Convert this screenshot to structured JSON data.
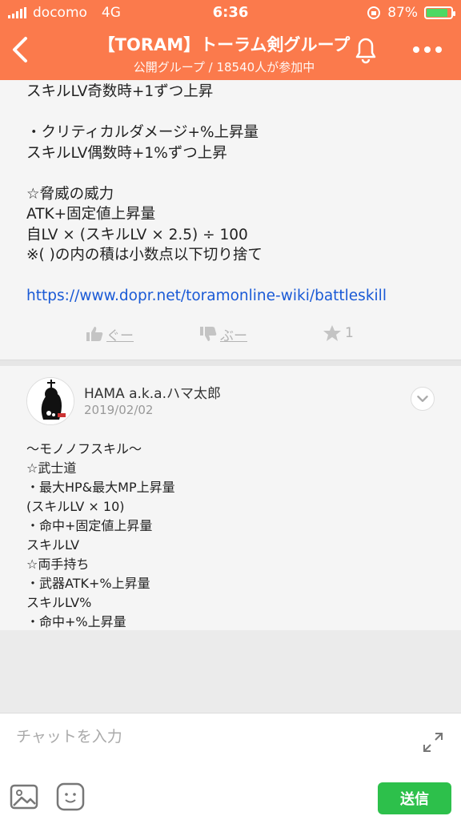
{
  "status": {
    "carrier": "docomo",
    "network": "4G",
    "time": "6:36",
    "battery": "87%",
    "battery_level": 0.87
  },
  "header": {
    "title": "【TORAM】トーラム剣グループ",
    "subtitle": "公開グループ / 18540人が参加中"
  },
  "post1": {
    "lines": [
      "スキルLV奇数時+1ずつ上昇",
      "",
      "・クリティカルダメージ+%上昇量",
      "スキルLV偶数時+1%ずつ上昇",
      "",
      "☆脅威の威力",
      "ATK+固定値上昇量",
      "自LV × (スキルLV × 2.5) ÷ 100",
      "※( )の内の積は小数点以下切り捨て",
      ""
    ],
    "link": "https://www.dopr.net/toramonline-wiki/battleskill",
    "like_label": "ぐー",
    "dislike_label": "ぶー",
    "star_count": "1"
  },
  "post2": {
    "author": "HAMA a.k.a.ハマ太郎",
    "date": "2019/02/02",
    "lines": [
      "〜モノノフスキル〜",
      "",
      "☆武士道",
      "・最大HP&最大MP上昇量",
      "(スキルLV × 10)",
      "",
      "・命中+固定値上昇量",
      "スキルLV",
      "",
      "☆両手持ち",
      "・武器ATK+%上昇量",
      "スキルLV%",
      "",
      "・命中+%上昇量"
    ]
  },
  "input": {
    "placeholder": "チャットを入力",
    "send_label": "送信"
  },
  "colors": {
    "header": "#fb7a4c",
    "send": "#2dc04b",
    "link": "#1a5ad6"
  }
}
